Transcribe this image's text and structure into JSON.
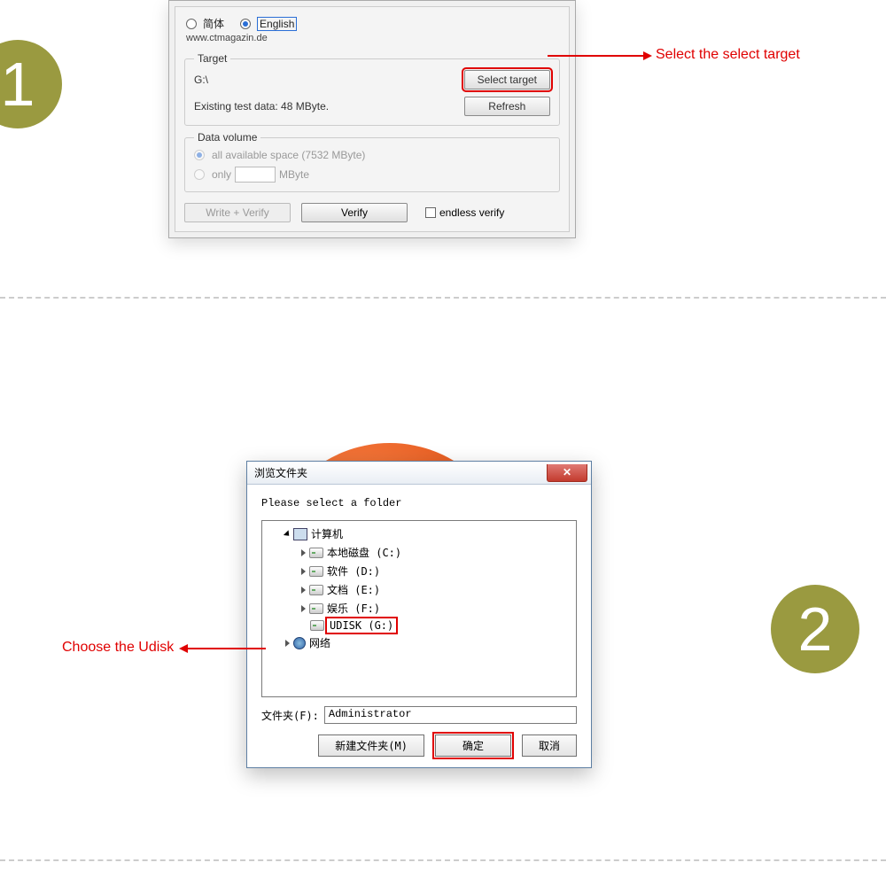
{
  "step1": {
    "lang_cn": "简体",
    "lang_en": "English",
    "url": "www.ctmagazin.de",
    "target_legend": "Target",
    "target_path": "G:\\",
    "select_target": "Select target",
    "existing_test": "Existing test data: 48 MByte.",
    "refresh": "Refresh",
    "datavol_legend": "Data volume",
    "opt_all": "all available space (7532 MByte)",
    "opt_only": "only",
    "opt_only_unit": "MByte",
    "write_verify": "Write + Verify",
    "verify": "Verify",
    "endless": "endless verify",
    "annotation": "Select the select target"
  },
  "step2": {
    "title": "浏览文件夹",
    "instruction": "Please select a folder",
    "tree": {
      "computer": "计算机",
      "c": "本地磁盘 (C:)",
      "d": "软件 (D:)",
      "e": "文档 (E:)",
      "f": "娱乐 (F:)",
      "g": "UDISK (G:)",
      "net": "网络"
    },
    "folder_label": "文件夹(F):",
    "folder_value": "Administrator",
    "new_folder": "新建文件夹(M)",
    "ok": "确定",
    "cancel": "取消",
    "annotation": "Choose the Udisk"
  },
  "badges": {
    "one": "1",
    "two": "2"
  }
}
